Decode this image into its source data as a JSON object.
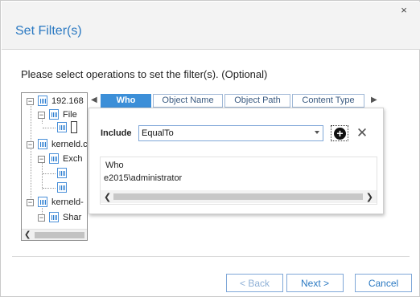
{
  "window": {
    "title": "Set Filter(s)",
    "close_glyph": "×"
  },
  "instruction": "Please select operations to set the filter(s). (Optional)",
  "tree": {
    "items": [
      {
        "label": "192.168",
        "level": 0
      },
      {
        "label": "File",
        "level": 1
      },
      {
        "label": "",
        "level": 2
      },
      {
        "label": "kerneld.c",
        "level": 0
      },
      {
        "label": "Exch",
        "level": 1
      },
      {
        "label": "",
        "level": 2
      },
      {
        "label": "",
        "level": 2
      },
      {
        "label": "kerneld-",
        "level": 0
      },
      {
        "label": "Shar",
        "level": 1
      }
    ]
  },
  "tabs": [
    {
      "label": "Who",
      "active": true
    },
    {
      "label": "Object Name",
      "active": false
    },
    {
      "label": "Object Path",
      "active": false
    },
    {
      "label": "Content Type",
      "active": false
    }
  ],
  "filter": {
    "include_label": "Include",
    "operator": "EqualTo",
    "grid_header": "Who",
    "grid_value": "e2015\\administrator"
  },
  "icons": {
    "add": "plus-circle-icon",
    "delete": "x-delete-icon",
    "tab_left": "chevron-left-icon",
    "tab_right": "chevron-right-icon"
  },
  "buttons": {
    "back": "< Back",
    "next": "Next >",
    "cancel": "Cancel"
  }
}
